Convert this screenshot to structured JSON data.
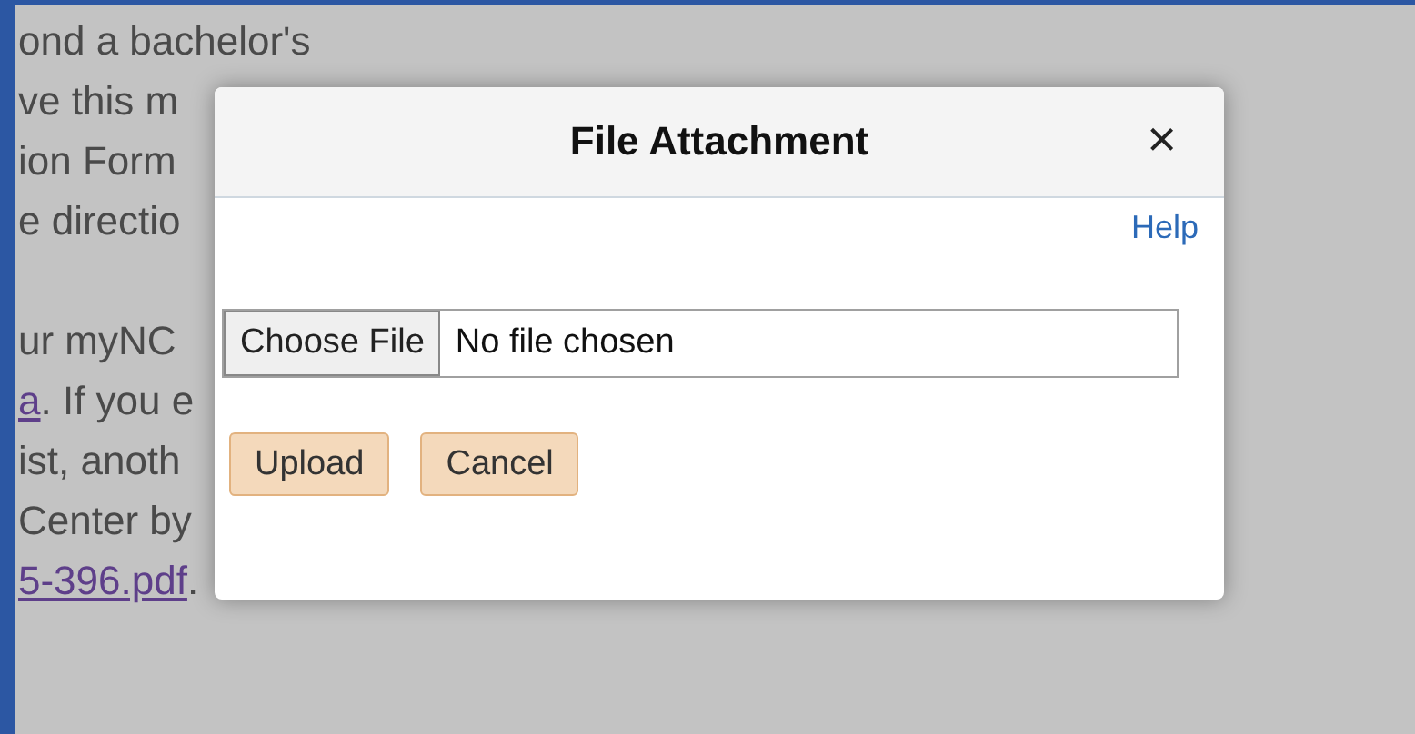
{
  "background_page": {
    "lines": [
      [
        {
          "text": "ond a bachelor's",
          "link": false
        }
      ],
      [
        {
          "text": "ve this m",
          "link": false
        }
      ],
      [
        {
          "text": "ion Form",
          "link": false
        }
      ],
      [
        {
          "text": "e directio",
          "link": false
        }
      ],
      [
        {
          "text": "ur myNC",
          "link": false,
          "gap_before": true
        }
      ],
      [
        {
          "text": "a",
          "link": true
        },
        {
          "text": ". If you e",
          "link": false
        }
      ],
      [
        {
          "text": "ist, anoth",
          "link": false
        }
      ],
      [
        {
          "text": "Center by",
          "link": false
        }
      ],
      [
        {
          "text": "5-396.pdf",
          "link": true
        },
        {
          "text": ".",
          "link": false
        }
      ]
    ]
  },
  "dialog": {
    "title": "File Attachment",
    "close": "×",
    "help": "Help",
    "file_button": "Choose File",
    "file_status": "No file chosen",
    "buttons": [
      "Upload",
      "Cancel"
    ]
  }
}
